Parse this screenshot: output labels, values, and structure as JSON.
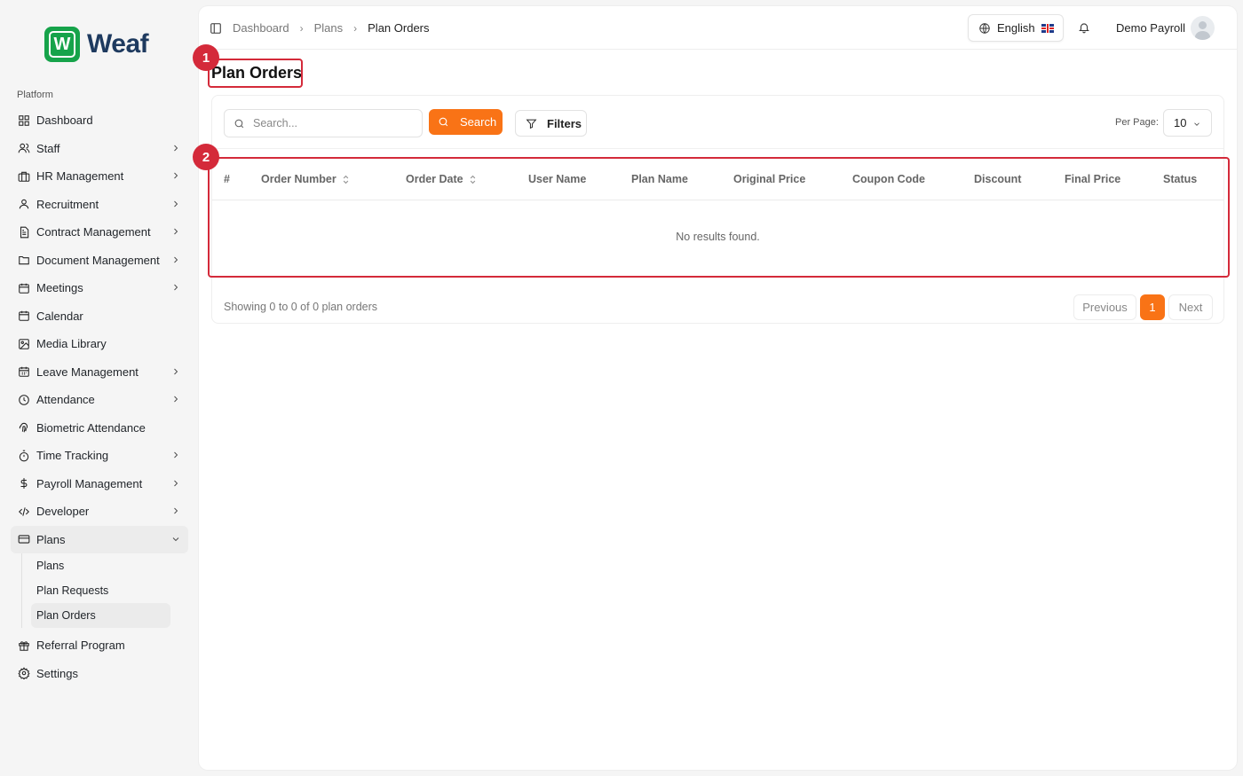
{
  "brand": {
    "logo_letter": "W",
    "name": "Weaf",
    "color": "#16a34a"
  },
  "sidebar": {
    "section_label": "Platform",
    "items": [
      {
        "label": "Dashboard",
        "icon": "grid-icon",
        "has_children": false
      },
      {
        "label": "Staff",
        "icon": "users-icon",
        "has_children": true
      },
      {
        "label": "HR Management",
        "icon": "briefcase-icon",
        "has_children": true
      },
      {
        "label": "Recruitment",
        "icon": "user-icon",
        "has_children": true
      },
      {
        "label": "Contract Management",
        "icon": "document-icon",
        "has_children": true
      },
      {
        "label": "Document Management",
        "icon": "folder-icon",
        "has_children": true
      },
      {
        "label": "Meetings",
        "icon": "calendar-icon",
        "has_children": true
      },
      {
        "label": "Calendar",
        "icon": "calendar-icon",
        "has_children": false
      },
      {
        "label": "Media Library",
        "icon": "image-icon",
        "has_children": false
      },
      {
        "label": "Leave Management",
        "icon": "calendar-grid-icon",
        "has_children": true
      },
      {
        "label": "Attendance",
        "icon": "clock-icon",
        "has_children": true
      },
      {
        "label": "Biometric Attendance",
        "icon": "fingerprint-icon",
        "has_children": false
      },
      {
        "label": "Time Tracking",
        "icon": "stopwatch-icon",
        "has_children": true
      },
      {
        "label": "Payroll Management",
        "icon": "dollar-icon",
        "has_children": true
      },
      {
        "label": "Developer",
        "icon": "code-icon",
        "has_children": true
      },
      {
        "label": "Plans",
        "icon": "credit-card-icon",
        "has_children": true,
        "expanded": true
      },
      {
        "label": "Referral Program",
        "icon": "gift-icon",
        "has_children": false
      },
      {
        "label": "Settings",
        "icon": "gear-icon",
        "has_children": false
      }
    ],
    "plans_sub": [
      "Plans",
      "Plan Requests",
      "Plan Orders"
    ]
  },
  "header": {
    "breadcrumbs": [
      "Dashboard",
      "Plans",
      "Plan Orders"
    ],
    "language": "English",
    "user_name": "Demo Payroll"
  },
  "page": {
    "title": "Plan Orders",
    "search_placeholder": "Search...",
    "search_button": "Search",
    "filters_button": "Filters",
    "per_page_label": "Per Page:",
    "per_page_value": "10",
    "columns": [
      "#",
      "Order Number",
      "Order Date",
      "User Name",
      "Plan Name",
      "Original Price",
      "Coupon Code",
      "Discount",
      "Final Price",
      "Status"
    ],
    "empty_text": "No results found.",
    "showing_text": "Showing 0 to 0 of 0 plan orders",
    "pagination": {
      "previous": "Previous",
      "current": "1",
      "next": "Next"
    }
  },
  "annotations": [
    "1",
    "2"
  ],
  "colors": {
    "accent": "#f97316",
    "highlight": "#d42a3a"
  }
}
